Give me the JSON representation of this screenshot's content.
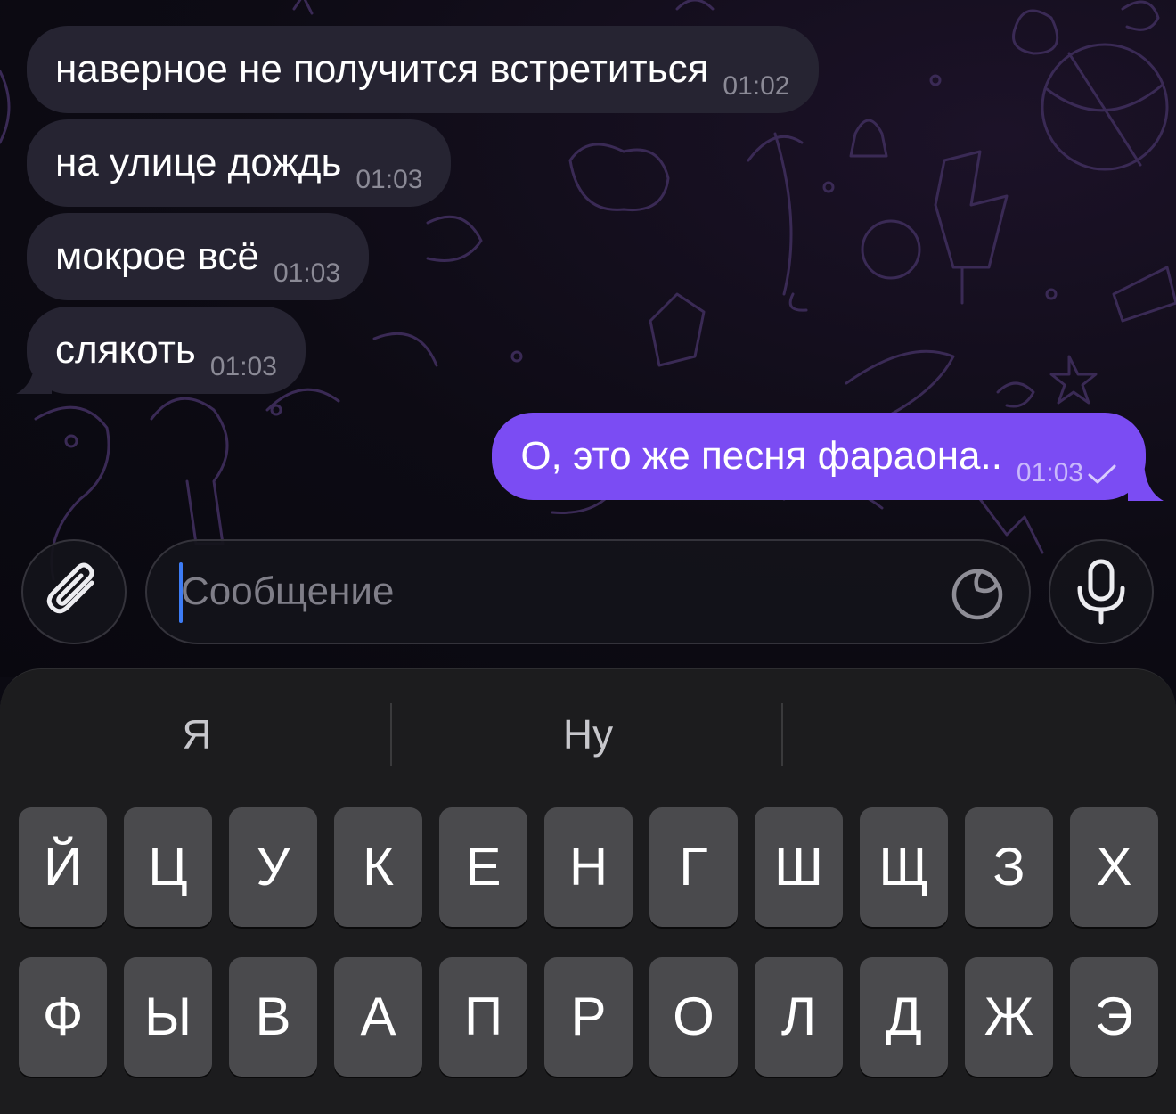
{
  "messages": [
    {
      "text": "наверное не получится встретиться",
      "time": "01:02",
      "direction": "incoming"
    },
    {
      "text": "на улице дождь",
      "time": "01:03",
      "direction": "incoming"
    },
    {
      "text": "мокрое всё",
      "time": "01:03",
      "direction": "incoming"
    },
    {
      "text": "слякоть",
      "time": "01:03",
      "direction": "incoming"
    },
    {
      "text": "О, это же песня фараона..",
      "time": "01:03",
      "direction": "outgoing",
      "status": "sent-checkmark"
    }
  ],
  "composer": {
    "placeholder": "Сообщение",
    "attach_icon": "paperclip-icon",
    "sticker_icon": "sticker-icon",
    "mic_icon": "microphone-icon"
  },
  "keyboard": {
    "suggestions": [
      "Я",
      "Ну",
      ""
    ],
    "row1": [
      "Й",
      "Ц",
      "У",
      "К",
      "Е",
      "Н",
      "Г",
      "Ш",
      "Щ",
      "З",
      "Х"
    ],
    "row2": [
      "Ф",
      "Ы",
      "В",
      "А",
      "П",
      "Р",
      "О",
      "Л",
      "Д",
      "Ж",
      "Э"
    ]
  },
  "colors": {
    "incoming_bubble": "#262432",
    "outgoing_bubble": "#7b4cf3",
    "keyboard_bg": "#1c1c1e",
    "key_bg": "#4a4a4d",
    "cursor": "#3d7cf5"
  }
}
